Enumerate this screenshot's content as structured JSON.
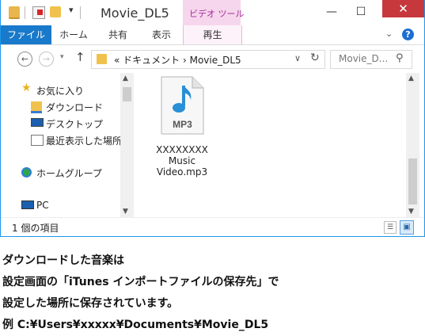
{
  "window": {
    "title": "Movie_DL5",
    "context_tab_title": "ビデオ ツール",
    "qat_dropdown_glyph": "▾",
    "minimize_glyph": "—",
    "maximize_glyph": "☐",
    "close_glyph": "✕"
  },
  "ribbon": {
    "tabs": [
      "ファイル",
      "ホーム",
      "共有",
      "表示",
      "再生"
    ],
    "expand_glyph": "⌄",
    "help_glyph": "?",
    "file_tab_color": "#1979ca",
    "context_color": "#f6d6ec"
  },
  "nav": {
    "back_glyph": "←",
    "forward_glyph": "→",
    "history_glyph": "▾",
    "up_glyph": "↑",
    "address": "« ドキュメント › Movie_DL5",
    "address_dropdown_glyph": "∨",
    "refresh_glyph": "↻",
    "search_placeholder": "Movie_D...",
    "search_glyph": "⚲"
  },
  "sidebar": {
    "items": [
      {
        "label": "お気に入り",
        "icon": "star-icon"
      },
      {
        "label": "ダウンロード",
        "icon": "downloads-folder-icon"
      },
      {
        "label": "デスクトップ",
        "icon": "desktop-icon"
      },
      {
        "label": "最近表示した場所",
        "icon": "recent-places-icon"
      },
      {
        "label": "ホームグループ",
        "icon": "homegroup-icon"
      },
      {
        "label": "PC",
        "icon": "pc-icon"
      }
    ],
    "scroll_up_glyph": "▲",
    "scroll_down_glyph": "▼"
  },
  "content": {
    "file": {
      "badge": "MP3",
      "name_lines": [
        "XXXXXXXX",
        "Music",
        "Video.mp3"
      ],
      "icon": "mp3-file-icon"
    },
    "scroll_up_glyph": "▲",
    "scroll_down_glyph": "▼"
  },
  "status": {
    "item_count": "1 個の項目",
    "details_view_glyph": "☰",
    "icons_view_glyph": "▣"
  },
  "caption": {
    "lines": [
      "ダウンロードした音楽は",
      "設定画面の「iTunes インポートファイルの保存先」で",
      "設定した場所に保存されています。",
      "例 C:¥Users¥xxxxx¥Documents¥Movie_DL5"
    ]
  }
}
